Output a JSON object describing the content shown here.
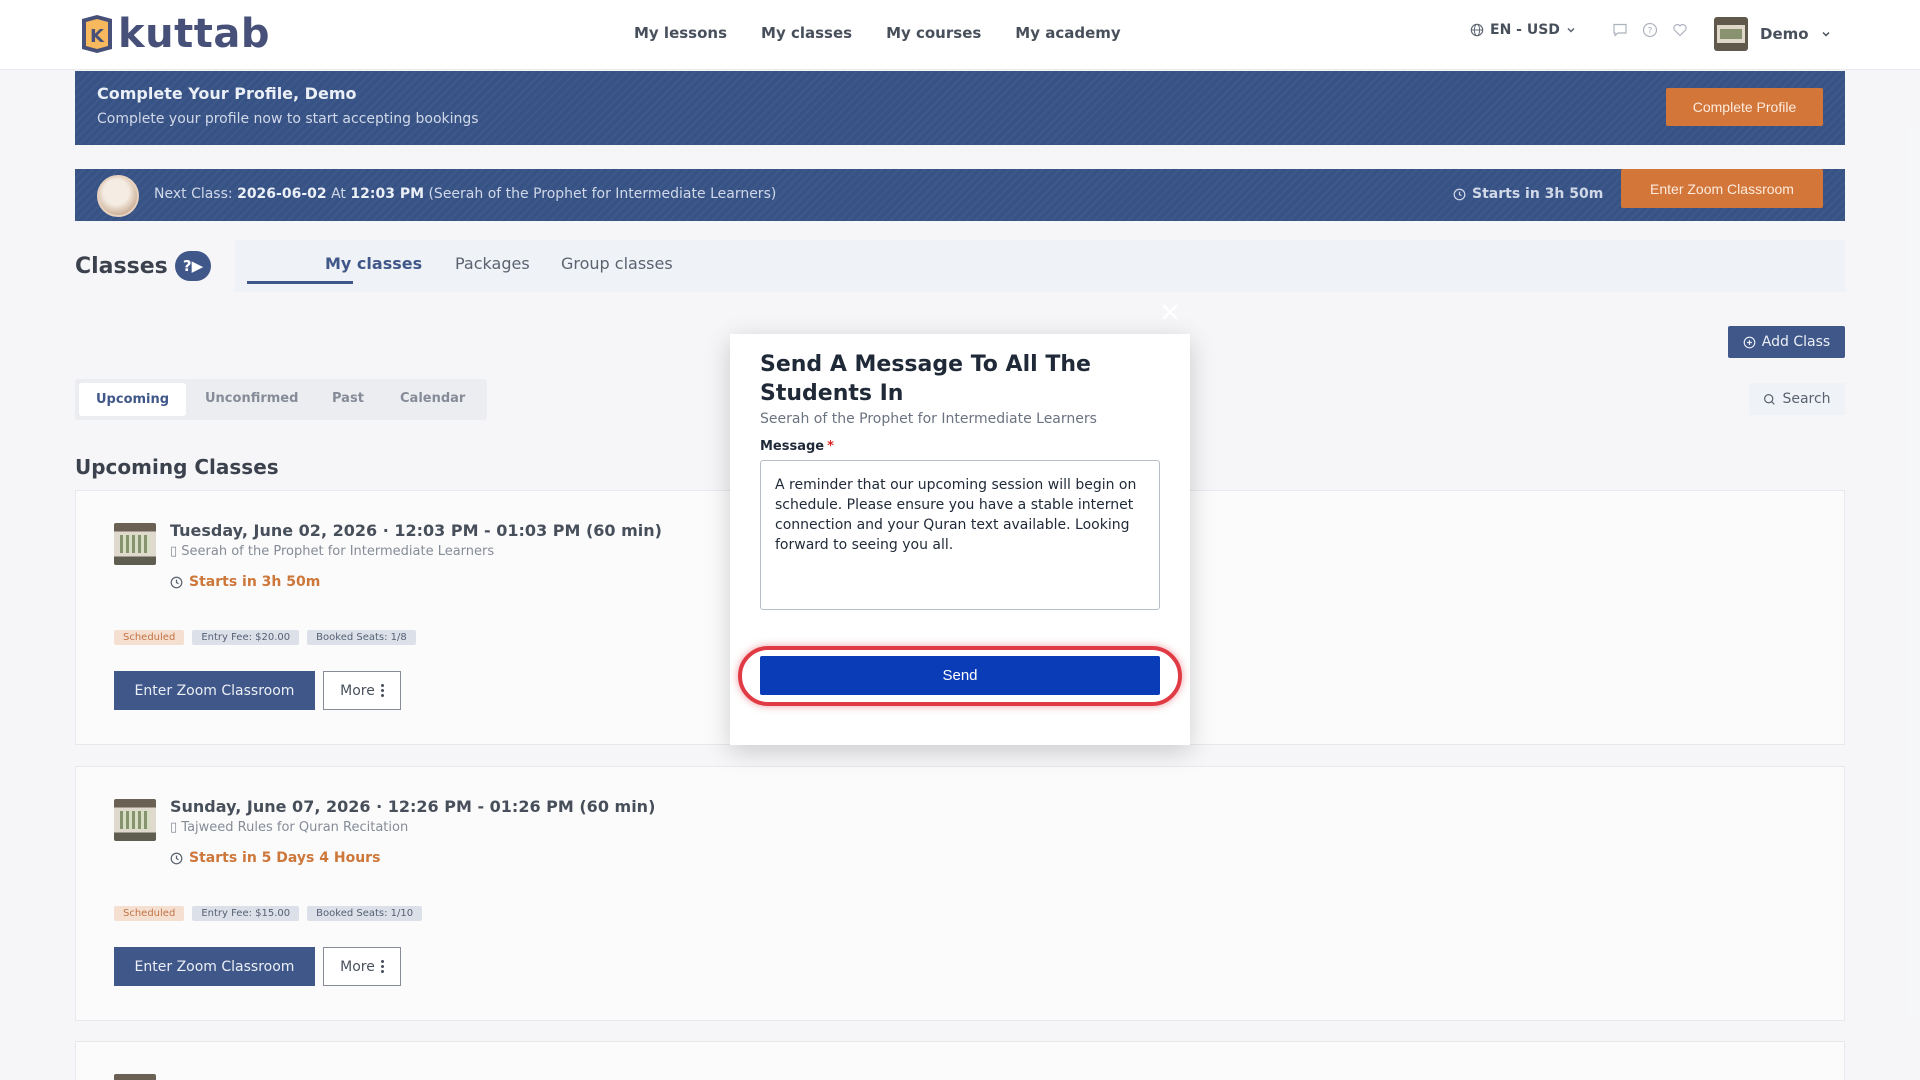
{
  "header": {
    "logo_text": "kuttab",
    "nav": [
      "My lessons",
      "My classes",
      "My courses",
      "My academy"
    ],
    "lang": "EN - USD",
    "user_name": "Demo"
  },
  "profile_banner": {
    "title": "Complete Your Profile, Demo",
    "subtitle": "Complete your profile now to start accepting bookings",
    "button": "Complete Profile"
  },
  "next_class": {
    "prefix": "Next Class:",
    "date": "2026-06-02",
    "at": "At",
    "time": "12:03 PM",
    "course": "(Seerah of the Prophet for Intermediate Learners)",
    "starts": "Starts in 3h 50m",
    "button": "Enter Zoom Classroom"
  },
  "classes": {
    "title": "Classes",
    "help": "?▶",
    "tabs": [
      "My classes",
      "Packages",
      "Group classes"
    ],
    "add_button": "Add Class",
    "filters": [
      "Upcoming",
      "Unconfirmed",
      "Past",
      "Calendar"
    ],
    "search": "Search",
    "upcoming_title": "Upcoming Classes"
  },
  "cards": [
    {
      "date": "Tuesday, June 02, 2026 · 12:03 PM - 01:03 PM (60 min)",
      "course": "▯ Seerah of the Prophet for Intermediate Learners",
      "starts": "Starts in 3h 50m",
      "badges": [
        "Scheduled",
        "Entry Fee: $20.00",
        "Booked Seats: 1/8"
      ],
      "zoom": "Enter Zoom Classroom",
      "more": "More"
    },
    {
      "date": "Sunday, June 07, 2026 · 12:26 PM - 01:26 PM (60 min)",
      "course": "▯ Tajweed Rules for Quran Recitation",
      "starts": "Starts in 5 Days 4 Hours",
      "badges": [
        "Scheduled",
        "Entry Fee: $15.00",
        "Booked Seats: 1/10"
      ],
      "zoom": "Enter Zoom Classroom",
      "more": "More"
    }
  ],
  "modal": {
    "title": "Send A Message To All The Students In",
    "subtitle": "Seerah of the Prophet for Intermediate Learners",
    "label": "Message",
    "required_mark": "*",
    "message": "A reminder that our upcoming session will begin on schedule. Please ensure you have a stable internet connection and your Quran text available. Looking forward to seeing you all.",
    "send": "Send"
  },
  "colors": {
    "brand_navy": "#17336f",
    "banner_navy": "#0c2d6b",
    "orange": "#c9580f",
    "send_blue": "#0b3cb8",
    "highlight_red": "#e03a45"
  }
}
